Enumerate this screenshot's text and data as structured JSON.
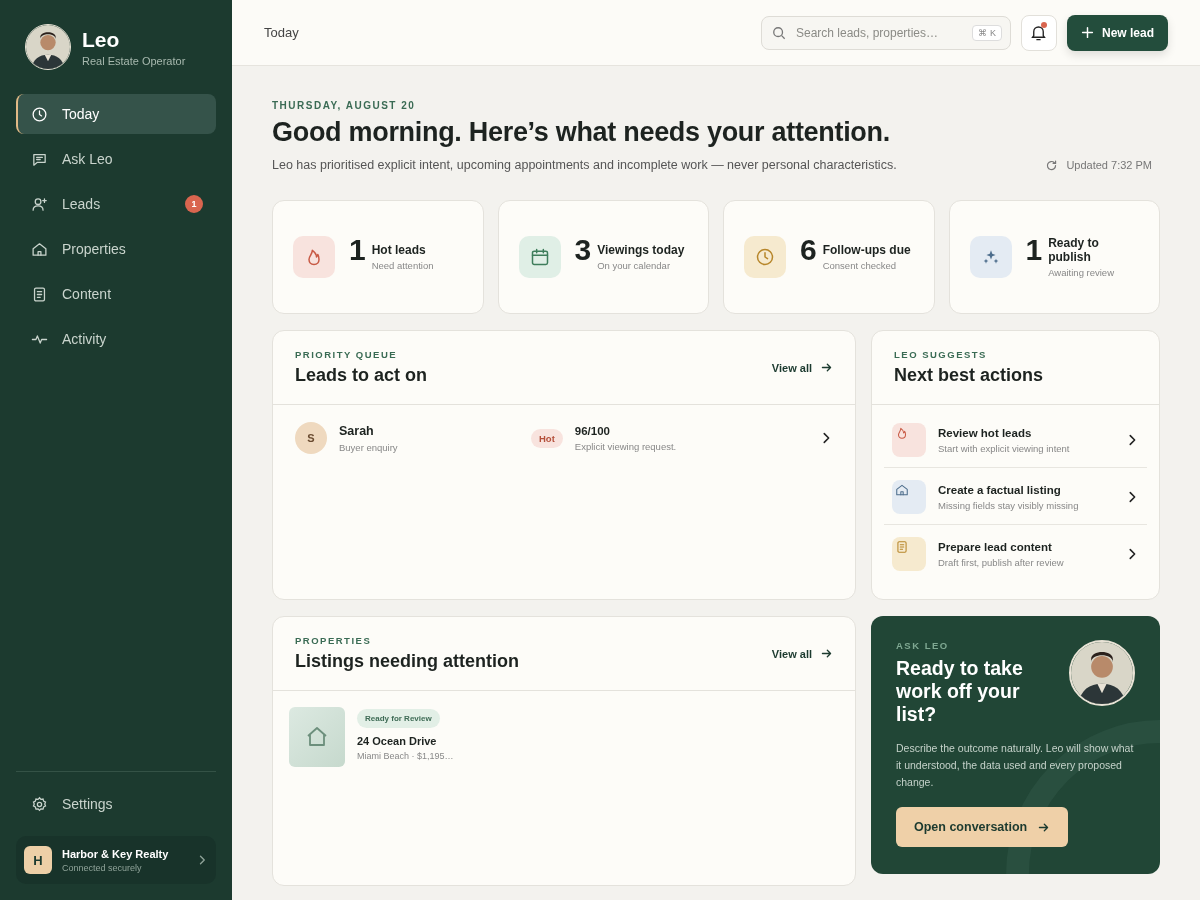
{
  "sidebar": {
    "profile": {
      "name": "Leo",
      "role": "Real Estate Operator"
    },
    "nav": [
      {
        "label": "Today",
        "selected": true
      },
      {
        "label": "Ask Leo",
        "selected": false
      },
      {
        "label": "Leads",
        "selected": false,
        "badge": "1"
      },
      {
        "label": "Properties",
        "selected": false
      },
      {
        "label": "Content",
        "selected": false
      },
      {
        "label": "Activity",
        "selected": false
      }
    ],
    "settings": "Settings",
    "account": {
      "initial": "H",
      "name": "Harbor & Key Realty",
      "status": "Connected securely"
    }
  },
  "header": {
    "title": "Today",
    "search": {
      "placeholder": "Search leads, properties…",
      "shortcut": "⌘ K"
    },
    "notifications": {
      "unread": true
    },
    "new_lead_button": "New lead"
  },
  "greeting": {
    "date": "THURSDAY, AUGUST 20",
    "title": "Good morning. Here’s what needs your attention.",
    "subtitle": "Leo has prioritised explicit intent, upcoming appointments and incomplete work — never personal characteristics.",
    "updated": "Updated 7:32 PM"
  },
  "stats": [
    {
      "value": "1",
      "label": "Hot leads",
      "sub": "Need attention"
    },
    {
      "value": "3",
      "label": "Viewings today",
      "sub": "On your calendar"
    },
    {
      "value": "6",
      "label": "Follow-ups due",
      "sub": "Consent checked"
    },
    {
      "value": "1",
      "label": "Ready to publish",
      "sub": "Awaiting review"
    }
  ],
  "priority_queue": {
    "eyebrow": "PRIORITY QUEUE",
    "title": "Leads to act on",
    "view_all": "View all",
    "leads": [
      {
        "initial": "S",
        "name": "Sarah",
        "source": "Buyer enquiry",
        "tag": "Hot",
        "score": "96/100",
        "reason": "Explicit viewing request."
      }
    ]
  },
  "suggestions": {
    "eyebrow": "LEO SUGGESTS",
    "title": "Next best actions",
    "actions": [
      {
        "title": "Review hot leads",
        "sub": "Start with explicit viewing intent"
      },
      {
        "title": "Create a factual listing",
        "sub": "Missing fields stay visibly missing"
      },
      {
        "title": "Prepare lead content",
        "sub": "Draft first, publish after review"
      }
    ]
  },
  "properties": {
    "eyebrow": "PROPERTIES",
    "title": "Listings needing attention",
    "view_all": "View all",
    "listings": [
      {
        "status": "Ready for Review",
        "title": "24 Ocean Drive",
        "details": "Miami Beach · $1,195…"
      }
    ]
  },
  "ask_leo": {
    "eyebrow": "ASK LEO",
    "title": "Ready to take work off your list?",
    "body": "Describe the outcome naturally. Leo will show what it understood, the data used and every proposed change.",
    "button": "Open conversation"
  }
}
